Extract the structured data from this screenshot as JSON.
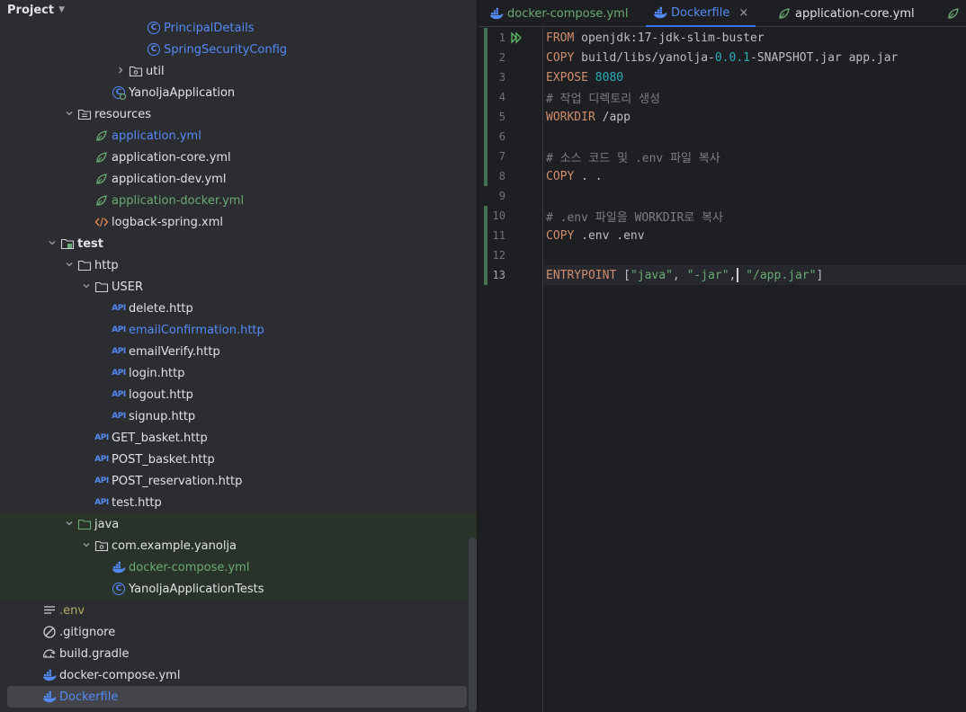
{
  "project_panel": {
    "title": "Project",
    "tree": [
      {
        "label": "PrincipalDetails",
        "icon": "class-icon",
        "indent": 164,
        "color": "blue",
        "partial": true
      },
      {
        "label": "SpringSecurityConfig",
        "icon": "class-icon",
        "indent": 164,
        "color": "blue"
      },
      {
        "label": "util",
        "icon": "package-folder-icon",
        "indent": 144,
        "color": "white",
        "arrow": "collapsed"
      },
      {
        "label": "YanoljaApplication",
        "icon": "spring-app-class-icon",
        "indent": 125,
        "color": "white"
      },
      {
        "label": "resources",
        "icon": "resources-folder-icon",
        "indent": 87,
        "color": "white",
        "arrow": "expanded"
      },
      {
        "label": "application.yml",
        "icon": "spring-yml-icon",
        "indent": 106,
        "color": "blue"
      },
      {
        "label": "application-core.yml",
        "icon": "spring-yml-icon",
        "indent": 106,
        "color": "white"
      },
      {
        "label": "application-dev.yml",
        "icon": "spring-yml-icon",
        "indent": 106,
        "color": "white"
      },
      {
        "label": "application-docker.yml",
        "icon": "spring-yml-icon",
        "indent": 106,
        "color": "green"
      },
      {
        "label": "logback-spring.xml",
        "icon": "xml-icon",
        "indent": 106,
        "color": "white"
      },
      {
        "label": "test",
        "icon": "test-folder-icon",
        "indent": 68,
        "color": "white",
        "arrow": "expanded",
        "bold": true
      },
      {
        "label": "http",
        "icon": "folder-icon",
        "indent": 87,
        "color": "white",
        "arrow": "expanded"
      },
      {
        "label": "USER",
        "icon": "folder-icon",
        "indent": 106,
        "color": "white",
        "arrow": "expanded"
      },
      {
        "label": "delete.http",
        "icon": "api-icon",
        "indent": 125,
        "color": "white"
      },
      {
        "label": "emailConfirmation.http",
        "icon": "api-icon",
        "indent": 125,
        "color": "blue"
      },
      {
        "label": "emailVerify.http",
        "icon": "api-icon",
        "indent": 125,
        "color": "white"
      },
      {
        "label": "login.http",
        "icon": "api-icon",
        "indent": 125,
        "color": "white"
      },
      {
        "label": "logout.http",
        "icon": "api-icon",
        "indent": 125,
        "color": "white"
      },
      {
        "label": "signup.http",
        "icon": "api-icon",
        "indent": 125,
        "color": "white"
      },
      {
        "label": "GET_basket.http",
        "icon": "api-icon",
        "indent": 106,
        "color": "white"
      },
      {
        "label": "POST_basket.http",
        "icon": "api-icon",
        "indent": 106,
        "color": "white"
      },
      {
        "label": "POST_reservation.http",
        "icon": "api-icon",
        "indent": 106,
        "color": "white"
      },
      {
        "label": "test.http",
        "icon": "api-icon",
        "indent": 106,
        "color": "white"
      },
      {
        "label": "java",
        "icon": "test-source-folder-icon",
        "indent": 87,
        "color": "white",
        "arrow": "expanded",
        "green_bg": true
      },
      {
        "label": "com.example.yanolja",
        "icon": "package-folder-icon",
        "indent": 106,
        "color": "white",
        "arrow": "expanded",
        "green_bg": true
      },
      {
        "label": "docker-compose.yml",
        "icon": "docker-icon",
        "indent": 125,
        "color": "green",
        "green_bg": true
      },
      {
        "label": "YanoljaApplicationTests",
        "icon": "class-icon",
        "indent": 125,
        "color": "white",
        "green_bg": true
      },
      {
        "label": ".env",
        "icon": "text-file-icon",
        "indent": 48,
        "color": "olive"
      },
      {
        "label": ".gitignore",
        "icon": "ignore-file-icon",
        "indent": 48,
        "color": "white"
      },
      {
        "label": "build.gradle",
        "icon": "gradle-icon",
        "indent": 48,
        "color": "white"
      },
      {
        "label": "docker-compose.yml",
        "icon": "docker-icon",
        "indent": 48,
        "color": "white"
      },
      {
        "label": "Dockerfile",
        "icon": "docker-icon",
        "indent": 48,
        "color": "blue",
        "selected": true
      }
    ]
  },
  "editor": {
    "tabs": [
      {
        "label": "docker-compose.yml",
        "icon": "docker-icon",
        "color": "green",
        "active": false
      },
      {
        "label": "Dockerfile",
        "icon": "docker-icon",
        "color": "blue",
        "active": true,
        "close": "×"
      },
      {
        "label": "application-core.yml",
        "icon": "spring-yml-icon",
        "color": "white",
        "active": false
      }
    ],
    "current_line": 13,
    "lines": [
      {
        "n": "1",
        "run": true,
        "vcs": true,
        "tokens": [
          {
            "t": "FROM",
            "c": "kw"
          },
          {
            "t": " openjdk:17-jdk-slim-buster",
            "c": ""
          }
        ]
      },
      {
        "n": "2",
        "vcs": true,
        "tokens": [
          {
            "t": "COPY",
            "c": "kw"
          },
          {
            "t": " build/libs/yanolja-",
            "c": ""
          },
          {
            "t": "0.0.1",
            "c": "num"
          },
          {
            "t": "-SNAPSHOT.jar app.jar",
            "c": ""
          }
        ]
      },
      {
        "n": "3",
        "vcs": true,
        "tokens": [
          {
            "t": "EXPOSE",
            "c": "kw"
          },
          {
            "t": " ",
            "c": ""
          },
          {
            "t": "8080",
            "c": "num"
          }
        ]
      },
      {
        "n": "4",
        "vcs": true,
        "tokens": [
          {
            "t": "# 작업 디렉토리 생성",
            "c": "cm"
          }
        ]
      },
      {
        "n": "5",
        "vcs": true,
        "tokens": [
          {
            "t": "WORKDIR",
            "c": "kw"
          },
          {
            "t": " /app",
            "c": ""
          }
        ]
      },
      {
        "n": "6",
        "vcs": true,
        "tokens": []
      },
      {
        "n": "7",
        "vcs": true,
        "tokens": [
          {
            "t": "# 소스 코드 및 .env 파일 복사",
            "c": "cm"
          }
        ]
      },
      {
        "n": "8",
        "vcs": true,
        "tokens": [
          {
            "t": "COPY",
            "c": "kw"
          },
          {
            "t": " . .",
            "c": ""
          }
        ]
      },
      {
        "n": "9",
        "vcs": false,
        "tokens": []
      },
      {
        "n": "10",
        "vcs": true,
        "tokens": [
          {
            "t": "# .env 파일을 WORKDIR로 복사",
            "c": "cm"
          }
        ]
      },
      {
        "n": "11",
        "vcs": true,
        "tokens": [
          {
            "t": "COPY",
            "c": "kw"
          },
          {
            "t": " .env .env",
            "c": ""
          }
        ]
      },
      {
        "n": "12",
        "vcs": true,
        "tokens": []
      },
      {
        "n": "13",
        "vcs": true,
        "tokens": [
          {
            "t": "ENTRYPOINT",
            "c": "kw"
          },
          {
            "t": " [",
            "c": ""
          },
          {
            "t": "\"java\"",
            "c": "str"
          },
          {
            "t": ", ",
            "c": ""
          },
          {
            "t": "\"-jar\"",
            "c": "str"
          },
          {
            "t": ",",
            "c": ""
          },
          {
            "t": "|",
            "c": "caret"
          },
          {
            "t": " ",
            "c": ""
          },
          {
            "t": "\"/app.jar\"",
            "c": "str"
          },
          {
            "t": "]",
            "c": ""
          }
        ]
      }
    ]
  },
  "colors": {
    "blue": "#548af7",
    "green": "#6aab73",
    "olive": "#b3ae60",
    "white": "#dfe1e5",
    "keyword": "#cf8e6d",
    "number": "#2aacb8",
    "comment": "#7a7e85",
    "accent": "#3574f0"
  }
}
